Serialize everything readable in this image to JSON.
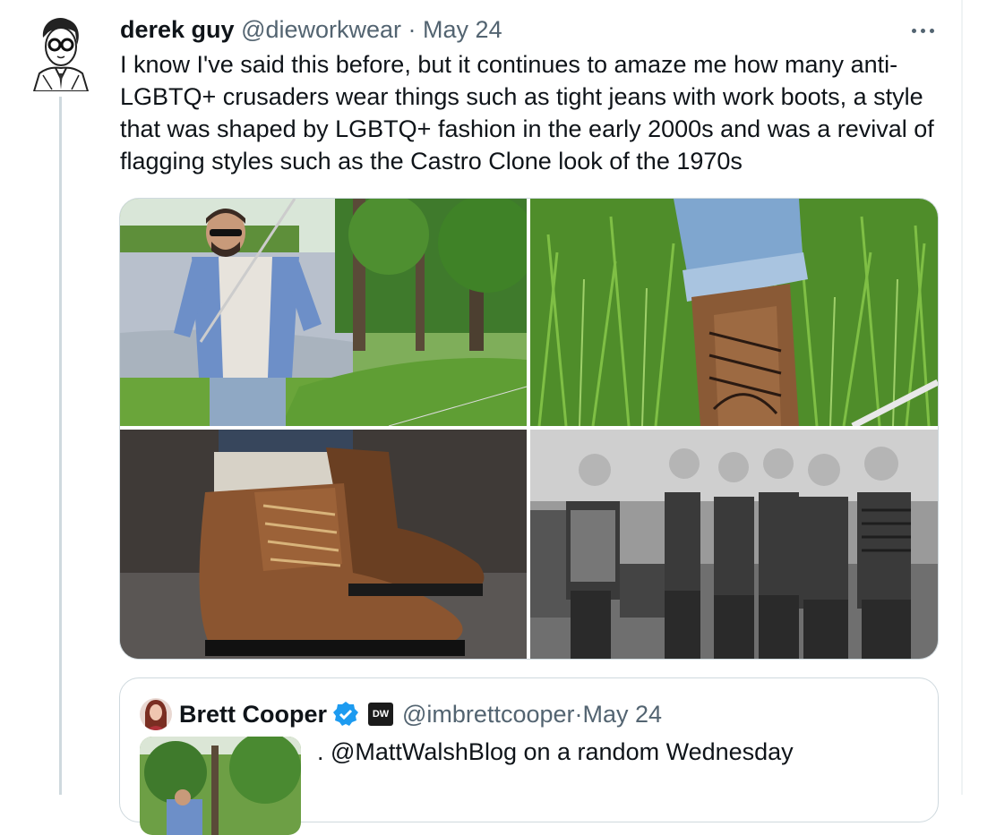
{
  "tweet": {
    "author_name": "derek guy",
    "handle": "@dieworkwear",
    "separator": " · ",
    "date": "May 24",
    "text": "I know I've said this before, but it continues to amaze me how many anti-LGBTQ+ crusaders wear things such as tight jeans with work boots, a style that was shaped by LGBTQ+ fashion in the early 2000s and was a revival of flagging styles such as the Castro Clone look of the 1970s",
    "avatar_icon": "cartoon-man-glasses-avatar",
    "more_icon": "more-dots-icon"
  },
  "media": {
    "photos": [
      {
        "name": "photo-man-fishing-by-lake"
      },
      {
        "name": "photo-boot-in-grass"
      },
      {
        "name": "photo-brown-work-boots"
      },
      {
        "name": "photo-castro-clone-group-1970s"
      }
    ]
  },
  "quote": {
    "author_name": "Brett Cooper",
    "verified_icon": "verified-badge-icon",
    "affiliate_badge": "DW",
    "handle": "@imbrettcooper",
    "separator": " · ",
    "date": "May 24",
    "text": ". @MattWalshBlog on a random Wednesday"
  },
  "colors": {
    "text": "#0f1419",
    "muted": "#536471",
    "border": "#cfd9de",
    "verified": "#1d9bf0"
  }
}
